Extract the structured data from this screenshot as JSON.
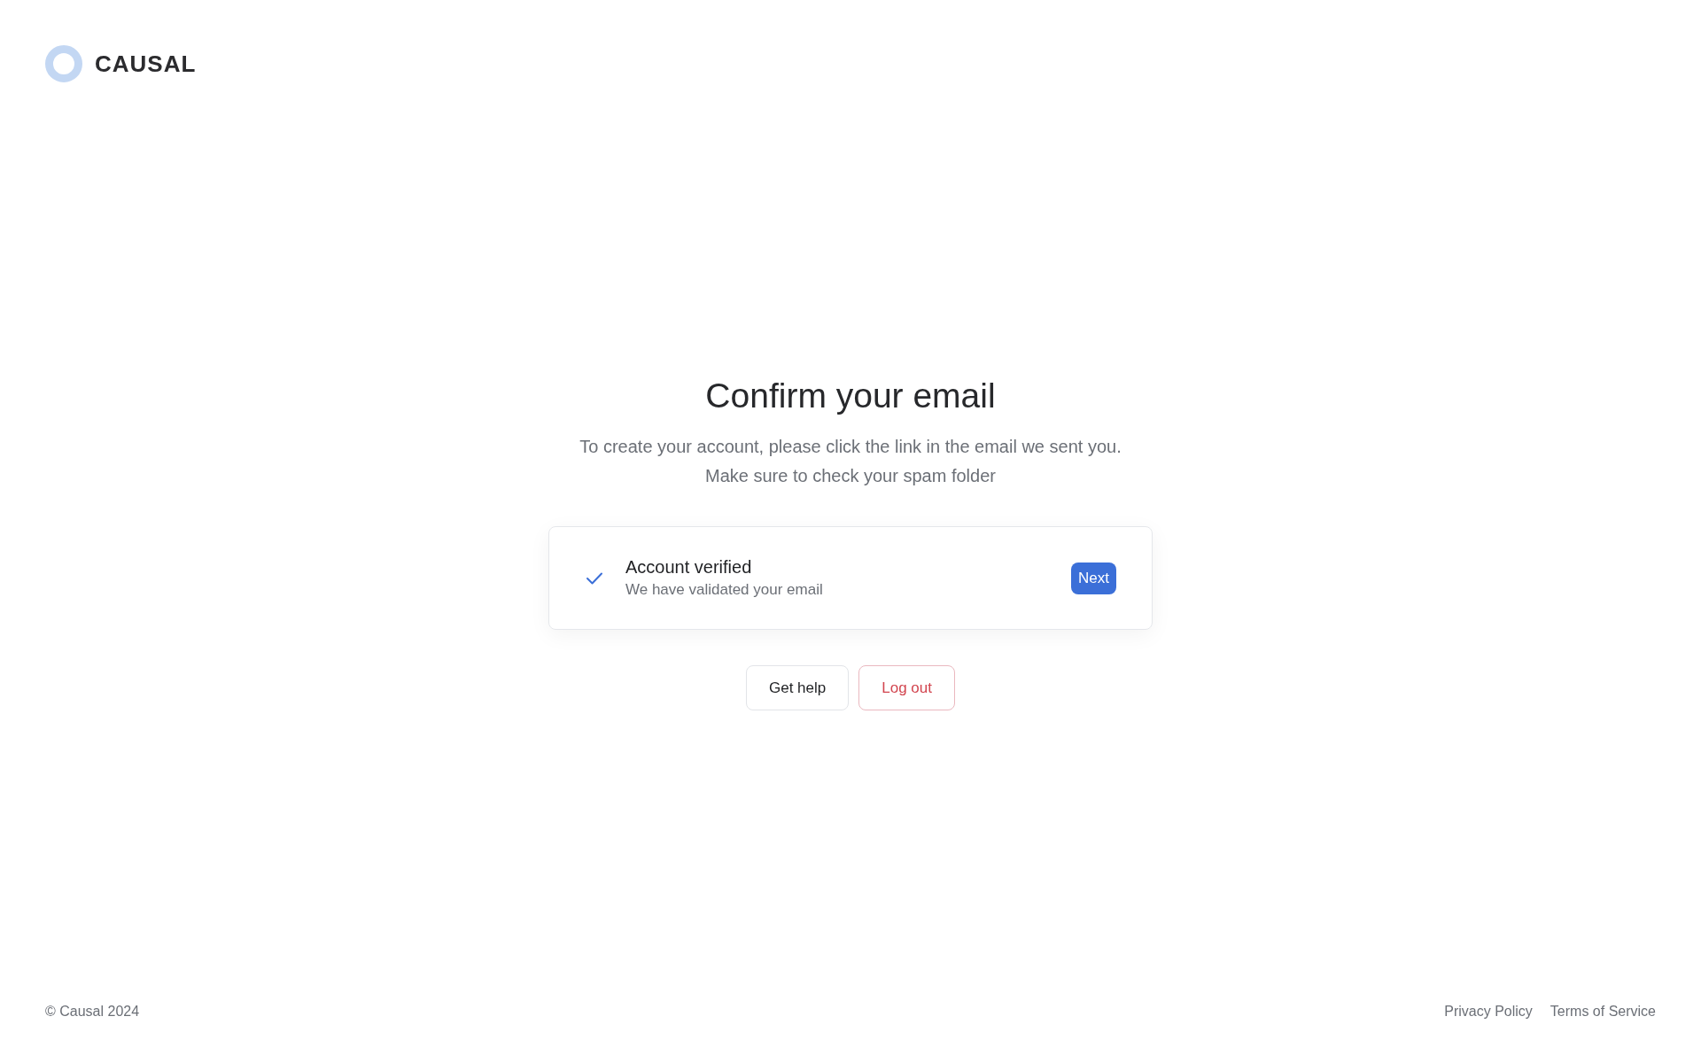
{
  "logo": {
    "text": "CAUSAL"
  },
  "heading": "Confirm your email",
  "description": [
    "To create your account, please click the link in the email we sent you.",
    "Make sure to check your spam folder"
  ],
  "status_card": {
    "verified": true,
    "title": "Account verified",
    "subtitle": "We have validated your email",
    "button": "Next"
  },
  "actions": [
    {
      "label": "Get help",
      "kind": "neutral"
    },
    {
      "label": "Log out",
      "kind": "danger"
    }
  ],
  "footer": {
    "copyright": "© Causal 2024",
    "links": [
      "Privacy Policy",
      "Terms of Service"
    ]
  }
}
